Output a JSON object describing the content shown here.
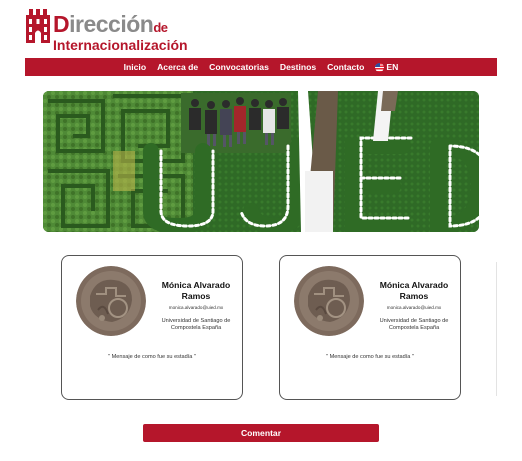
{
  "header": {
    "logo_line1_first": "D",
    "logo_line1_rest": "irección",
    "logo_line1_de": "de",
    "logo_line2": "Internacionalización"
  },
  "nav": {
    "items": [
      {
        "label": "Inicio"
      },
      {
        "label": "Acerca de"
      },
      {
        "label": "Convocatorias"
      },
      {
        "label": "Destinos"
      },
      {
        "label": "Contacto"
      }
    ],
    "language": {
      "label": "EN",
      "icon": "us-flag-icon"
    }
  },
  "hero": {
    "image": "group-photo-garden-uied-letters"
  },
  "cards": [
    {
      "name": "Mónica Alvarado Ramos",
      "email": "monica.alvarado@uied.mx",
      "university": "Universidad de Santiago de Compostela España",
      "message": "\" Mensaje de como fue su estadía \""
    },
    {
      "name": "Mónica Alvarado Ramos",
      "email": "monica.alvarado@uied.mx",
      "university": "Universidad de Santiago de Compostela España",
      "message": "\" Mensaje de como fue su estadía \""
    }
  ],
  "comment_button": {
    "label": "Comentar"
  },
  "colors": {
    "brand": "#b5162b",
    "logo_gray": "#8a8a8a"
  }
}
